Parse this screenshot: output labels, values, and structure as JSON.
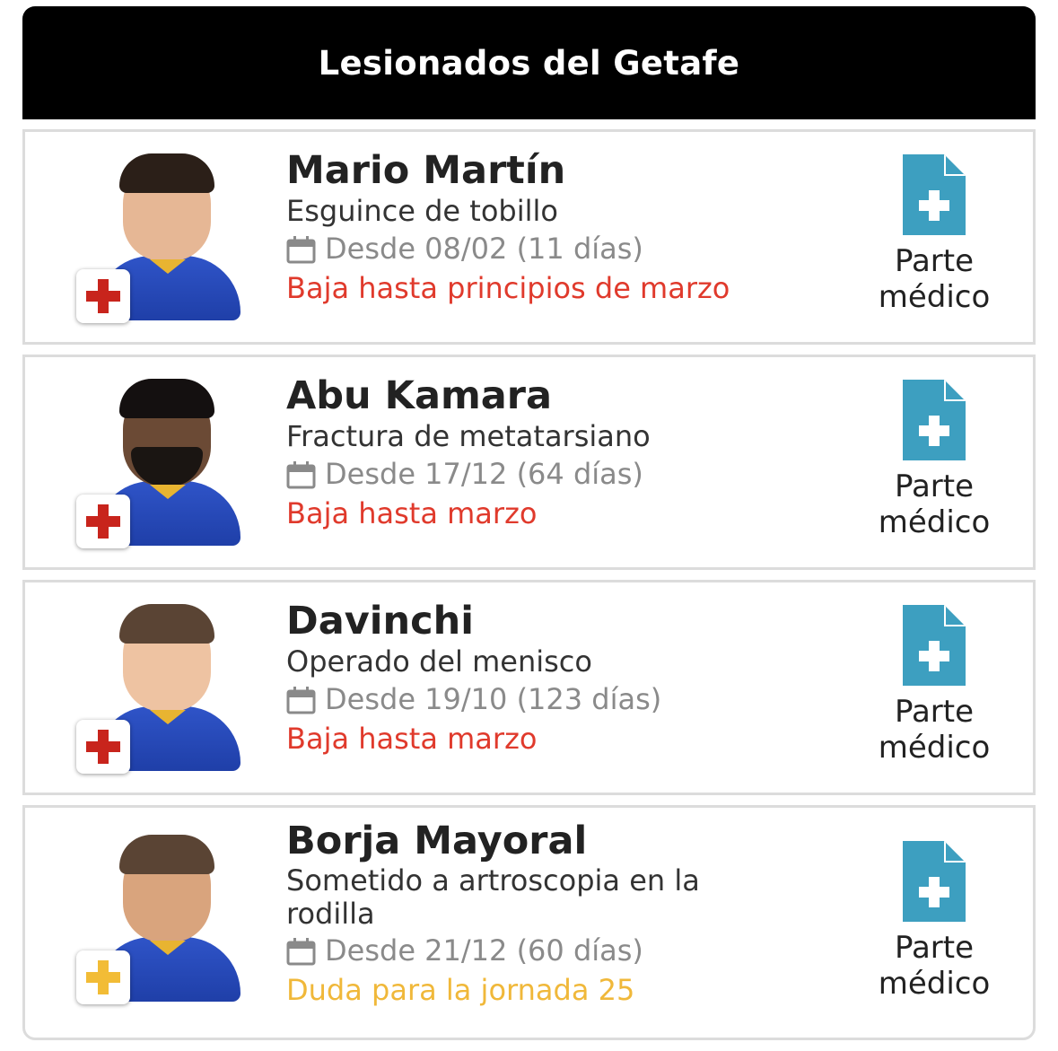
{
  "header": {
    "title": "Lesionados del Getafe"
  },
  "colors": {
    "red": "#e03a2c",
    "yellow": "#f0b83a",
    "doc_blue": "#3d9fc0",
    "badge_red": "#c8241c",
    "badge_yellow": "#f2bc36"
  },
  "players": [
    {
      "name": "Mario Martín",
      "injury": "Esguince de tobillo",
      "since": "Desde 08/02 (11 días)",
      "status": "Baja hasta principios de marzo",
      "severity": "red",
      "medical_label_1": "Parte",
      "medical_label_2": "médico",
      "badge_icon": "red-cross-icon"
    },
    {
      "name": "Abu Kamara",
      "injury": "Fractura de metatarsiano",
      "since": "Desde 17/12 (64 días)",
      "status": "Baja hasta marzo",
      "severity": "red",
      "medical_label_1": "Parte",
      "medical_label_2": "médico",
      "badge_icon": "red-cross-icon"
    },
    {
      "name": "Davinchi",
      "injury": "Operado del menisco",
      "since": "Desde 19/10 (123 días)",
      "status": "Baja hasta marzo",
      "severity": "red",
      "medical_label_1": "Parte",
      "medical_label_2": "médico",
      "badge_icon": "red-cross-icon"
    },
    {
      "name": "Borja Mayoral",
      "injury": "Sometido a artroscopia en la rodilla",
      "since": "Desde 21/12 (60 días)",
      "status": "Duda para la jornada 25",
      "severity": "yellow",
      "medical_label_1": "Parte",
      "medical_label_2": "médico",
      "badge_icon": "yellow-cross-icon"
    }
  ]
}
